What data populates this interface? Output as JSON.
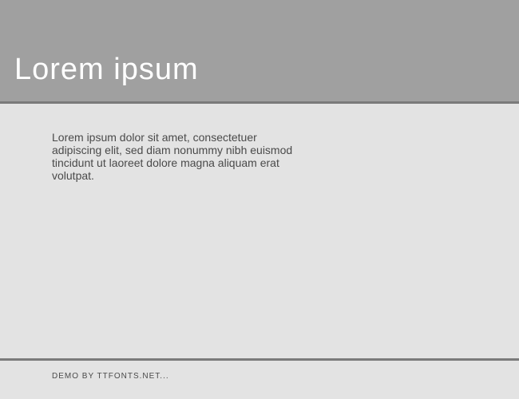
{
  "header": {
    "title": "Lorem ipsum"
  },
  "main": {
    "body": "Lorem ipsum dolor sit amet, consectetuer adipiscing elit, sed diam nonummy nibh euismod tincidunt ut laoreet dolore magna aliquam erat volutpat."
  },
  "footer": {
    "credit": "DEMO BY TTFONTS.NET..."
  }
}
